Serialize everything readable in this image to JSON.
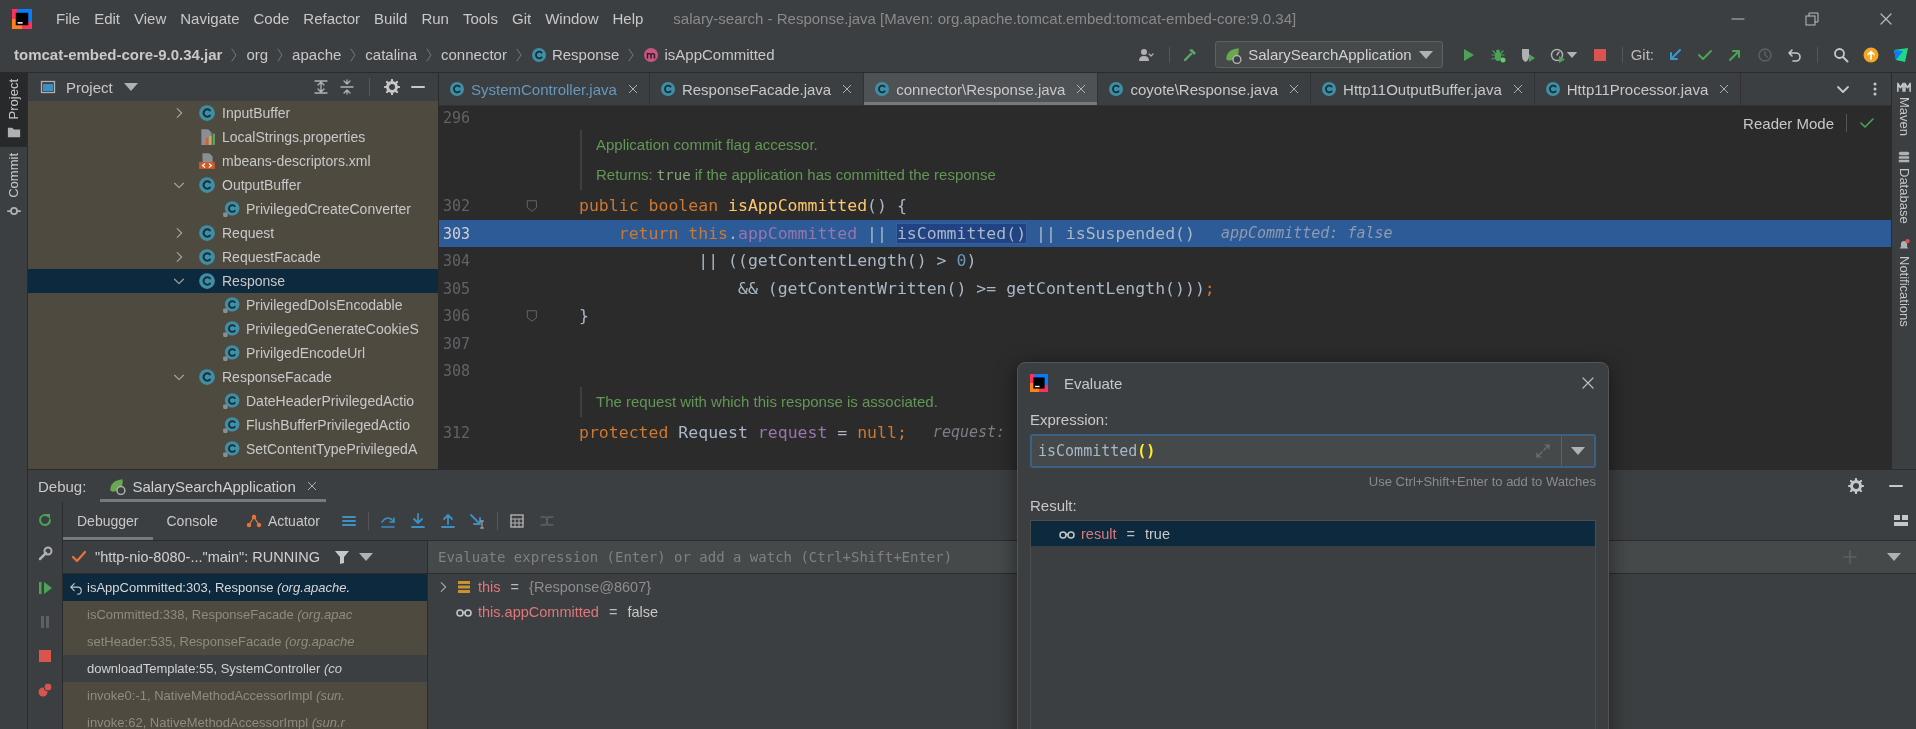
{
  "menu": [
    "File",
    "Edit",
    "View",
    "Navigate",
    "Code",
    "Refactor",
    "Build",
    "Run",
    "Tools",
    "Git",
    "Window",
    "Help"
  ],
  "window_title": "salary-search - Response.java [Maven: org.apache.tomcat.embed:tomcat-embed-core:9.0.34]",
  "breadcrumbs": [
    {
      "label": "tomcat-embed-core-9.0.34.jar",
      "kind": "jar"
    },
    {
      "label": "org",
      "kind": "package"
    },
    {
      "label": "apache",
      "kind": "package"
    },
    {
      "label": "catalina",
      "kind": "package"
    },
    {
      "label": "connector",
      "kind": "package"
    },
    {
      "label": "Response",
      "kind": "class"
    },
    {
      "label": "isAppCommitted",
      "kind": "method"
    }
  ],
  "toolbar": {
    "run_configuration": "SalarySearchApplication",
    "git_label": "Git:"
  },
  "tool_strip": [
    {
      "label": "Project",
      "selected": true
    },
    {
      "label": "Commit",
      "selected": false
    }
  ],
  "right_strip": [
    {
      "label": "Maven",
      "kind": "maven"
    },
    {
      "label": "Database",
      "kind": "database"
    },
    {
      "label": "Notifications",
      "kind": "notifications"
    }
  ],
  "project": {
    "title": "Project",
    "tree": [
      {
        "label": "InputBuffer",
        "kind": "class",
        "expandable": true,
        "expanded": false,
        "selected": false
      },
      {
        "label": "LocalStrings.properties",
        "kind": "properties",
        "expandable": false,
        "expanded": false,
        "selected": false
      },
      {
        "label": "mbeans-descriptors.xml",
        "kind": "xml",
        "expandable": false,
        "expanded": false,
        "selected": false
      },
      {
        "label": "OutputBuffer",
        "kind": "class",
        "expandable": true,
        "expanded": true,
        "selected": false,
        "children": [
          {
            "label": "PrivilegedCreateConverter",
            "kind": "inner-class",
            "expandable": false,
            "expanded": false,
            "selected": false
          }
        ]
      },
      {
        "label": "Request",
        "kind": "class",
        "expandable": true,
        "expanded": false,
        "selected": false
      },
      {
        "label": "RequestFacade",
        "kind": "class",
        "expandable": true,
        "expanded": false,
        "selected": false
      },
      {
        "label": "Response",
        "kind": "class",
        "expandable": true,
        "expanded": true,
        "selected": true,
        "children": [
          {
            "label": "PrivilegedDoIsEncodable",
            "kind": "inner-class",
            "expandable": false,
            "expanded": false,
            "selected": false
          },
          {
            "label": "PrivilegedGenerateCookieS",
            "kind": "inner-class",
            "expandable": false,
            "expanded": false,
            "selected": false
          },
          {
            "label": "PrivilgedEncodeUrl",
            "kind": "inner-class",
            "expandable": false,
            "expanded": false,
            "selected": false
          }
        ]
      },
      {
        "label": "ResponseFacade",
        "kind": "class",
        "expandable": true,
        "expanded": true,
        "selected": false,
        "children": [
          {
            "label": "DateHeaderPrivilegedActio",
            "kind": "inner-class",
            "expandable": false,
            "expanded": false,
            "selected": false
          },
          {
            "label": "FlushBufferPrivilegedActio",
            "kind": "inner-class",
            "expandable": false,
            "expanded": false,
            "selected": false
          },
          {
            "label": "SetContentTypePrivilegedA",
            "kind": "inner-class",
            "expandable": false,
            "expanded": false,
            "selected": false
          }
        ]
      }
    ]
  },
  "editor": {
    "tabs": [
      {
        "label": "SystemController.java",
        "selected": false,
        "vcs_modified": true
      },
      {
        "label": "ResponseFacade.java",
        "selected": false,
        "vcs_modified": false
      },
      {
        "label": "connector\\Response.java",
        "selected": true,
        "vcs_modified": false
      },
      {
        "label": "coyote\\Response.java",
        "selected": false,
        "vcs_modified": false
      },
      {
        "label": "Http11OutputBuffer.java",
        "selected": false,
        "vcs_modified": false
      },
      {
        "label": "Http11Processor.java",
        "selected": false,
        "vcs_modified": false
      }
    ],
    "reader_mode": "Reader Mode",
    "lines": [
      {
        "kind": "code",
        "number": "296",
        "current": false,
        "fold": false
      },
      {
        "kind": "doc",
        "rows": [
          [
            {
              "t": "Application commit flag accessor.",
              "kind": "doc"
            }
          ],
          [
            {
              "t": "Returns: ",
              "kind": "doc"
            },
            {
              "t": "true",
              "kind": "doc-code"
            },
            {
              "t": " if the application has committed the response",
              "kind": "doc"
            }
          ]
        ]
      },
      {
        "kind": "code",
        "number": "302",
        "current": false,
        "fold": true,
        "tokens": [
          {
            "t": "public boolean ",
            "kind": "keyword"
          },
          {
            "t": "isAppCommitted",
            "kind": "method"
          },
          {
            "t": "() {",
            "kind": "plain"
          }
        ]
      },
      {
        "kind": "code",
        "number": "303",
        "current": true,
        "fold": false,
        "tokens": [
          {
            "t": "    return this",
            "kind": "keyword"
          },
          {
            "t": ".",
            "kind": "plain"
          },
          {
            "t": "appCommitted",
            "kind": "field"
          },
          {
            "t": " || ",
            "kind": "plain"
          },
          {
            "t": "isCommitted()",
            "kind": "boxed"
          },
          {
            "t": " || isSuspended()",
            "kind": "plain"
          },
          {
            "t": "appCommitted: false",
            "kind": "hint"
          }
        ]
      },
      {
        "kind": "code",
        "number": "304",
        "current": false,
        "fold": false,
        "tokens": [
          {
            "t": "            || ((getContentLength() > ",
            "kind": "plain"
          },
          {
            "t": "0",
            "kind": "number"
          },
          {
            "t": ")",
            "kind": "plain"
          }
        ]
      },
      {
        "kind": "code",
        "number": "305",
        "current": false,
        "fold": false,
        "tokens": [
          {
            "t": "                && (getContentWritten() >= getContentLength()))",
            "kind": "plain"
          },
          {
            "t": ";",
            "kind": "keyword"
          }
        ]
      },
      {
        "kind": "code",
        "number": "306",
        "current": false,
        "fold": true,
        "tokens": [
          {
            "t": "}",
            "kind": "plain"
          }
        ]
      },
      {
        "kind": "code",
        "number": "307",
        "current": false,
        "fold": false
      },
      {
        "kind": "code",
        "number": "308",
        "current": false,
        "fold": false
      },
      {
        "kind": "doc",
        "rows": [
          [
            {
              "t": "The request with which this response is associated.",
              "kind": "doc"
            }
          ]
        ]
      },
      {
        "kind": "code",
        "number": "312",
        "current": false,
        "fold": false,
        "tokens": [
          {
            "t": "protected ",
            "kind": "keyword"
          },
          {
            "t": "Request ",
            "kind": "plain"
          },
          {
            "t": "request",
            "kind": "field"
          },
          {
            "t": " = ",
            "kind": "plain"
          },
          {
            "t": "null;",
            "kind": "keyword"
          },
          {
            "t": "request:",
            "kind": "hint"
          }
        ]
      }
    ]
  },
  "debug": {
    "title": "Debug:",
    "session": "SalarySearchApplication",
    "tabs": [
      {
        "label": "Debugger",
        "selected": true,
        "kind": "plain"
      },
      {
        "label": "Console",
        "selected": false,
        "kind": "plain"
      },
      {
        "label": "Actuator",
        "selected": false,
        "kind": "actuator"
      }
    ],
    "thread": "\"http-nio-8080-...\"main\": RUNNING",
    "frames": [
      {
        "location": "isAppCommitted:303, Response",
        "package": "(org.apache.",
        "kind": "library",
        "selected": true
      },
      {
        "location": "isCommitted:338, ResponseFacade",
        "package": "(org.apac",
        "kind": "library",
        "selected": false
      },
      {
        "location": "setHeader:535, ResponseFacade",
        "package": "(org.apache",
        "kind": "library",
        "selected": false
      },
      {
        "location": "downloadTemplate:55, SystemController",
        "package": "(co",
        "kind": "project",
        "selected": false
      },
      {
        "location": "invoke0:-1, NativeMethodAccessorImpl",
        "package": "(sun.",
        "kind": "library",
        "selected": false
      },
      {
        "location": "invoke:62, NativeMethodAccessorImpl",
        "package": "(sun.r",
        "kind": "library",
        "selected": false
      }
    ],
    "variables": {
      "placeholder": "Evaluate expression (Enter) or add a watch (Ctrl+Shift+Enter)",
      "items": [
        {
          "name": "this",
          "operator": "=",
          "value": "{Response@8607}",
          "kind": "object",
          "expandable": true
        },
        {
          "name": "this.appCommitted",
          "operator": "=",
          "value": "false",
          "kind": "watch",
          "expandable": false
        }
      ]
    }
  },
  "evaluate": {
    "title": "Evaluate",
    "expression_label": "Expression:",
    "expression": [
      {
        "t": "isCommitted",
        "kind": "plain"
      },
      {
        "t": "()",
        "kind": "brace-match"
      }
    ],
    "hint": "Use Ctrl+Shift+Enter to add to Watches",
    "result_label": "Result:",
    "results": [
      {
        "name": "result",
        "operator": "=",
        "value": "true",
        "selected": true
      }
    ]
  }
}
